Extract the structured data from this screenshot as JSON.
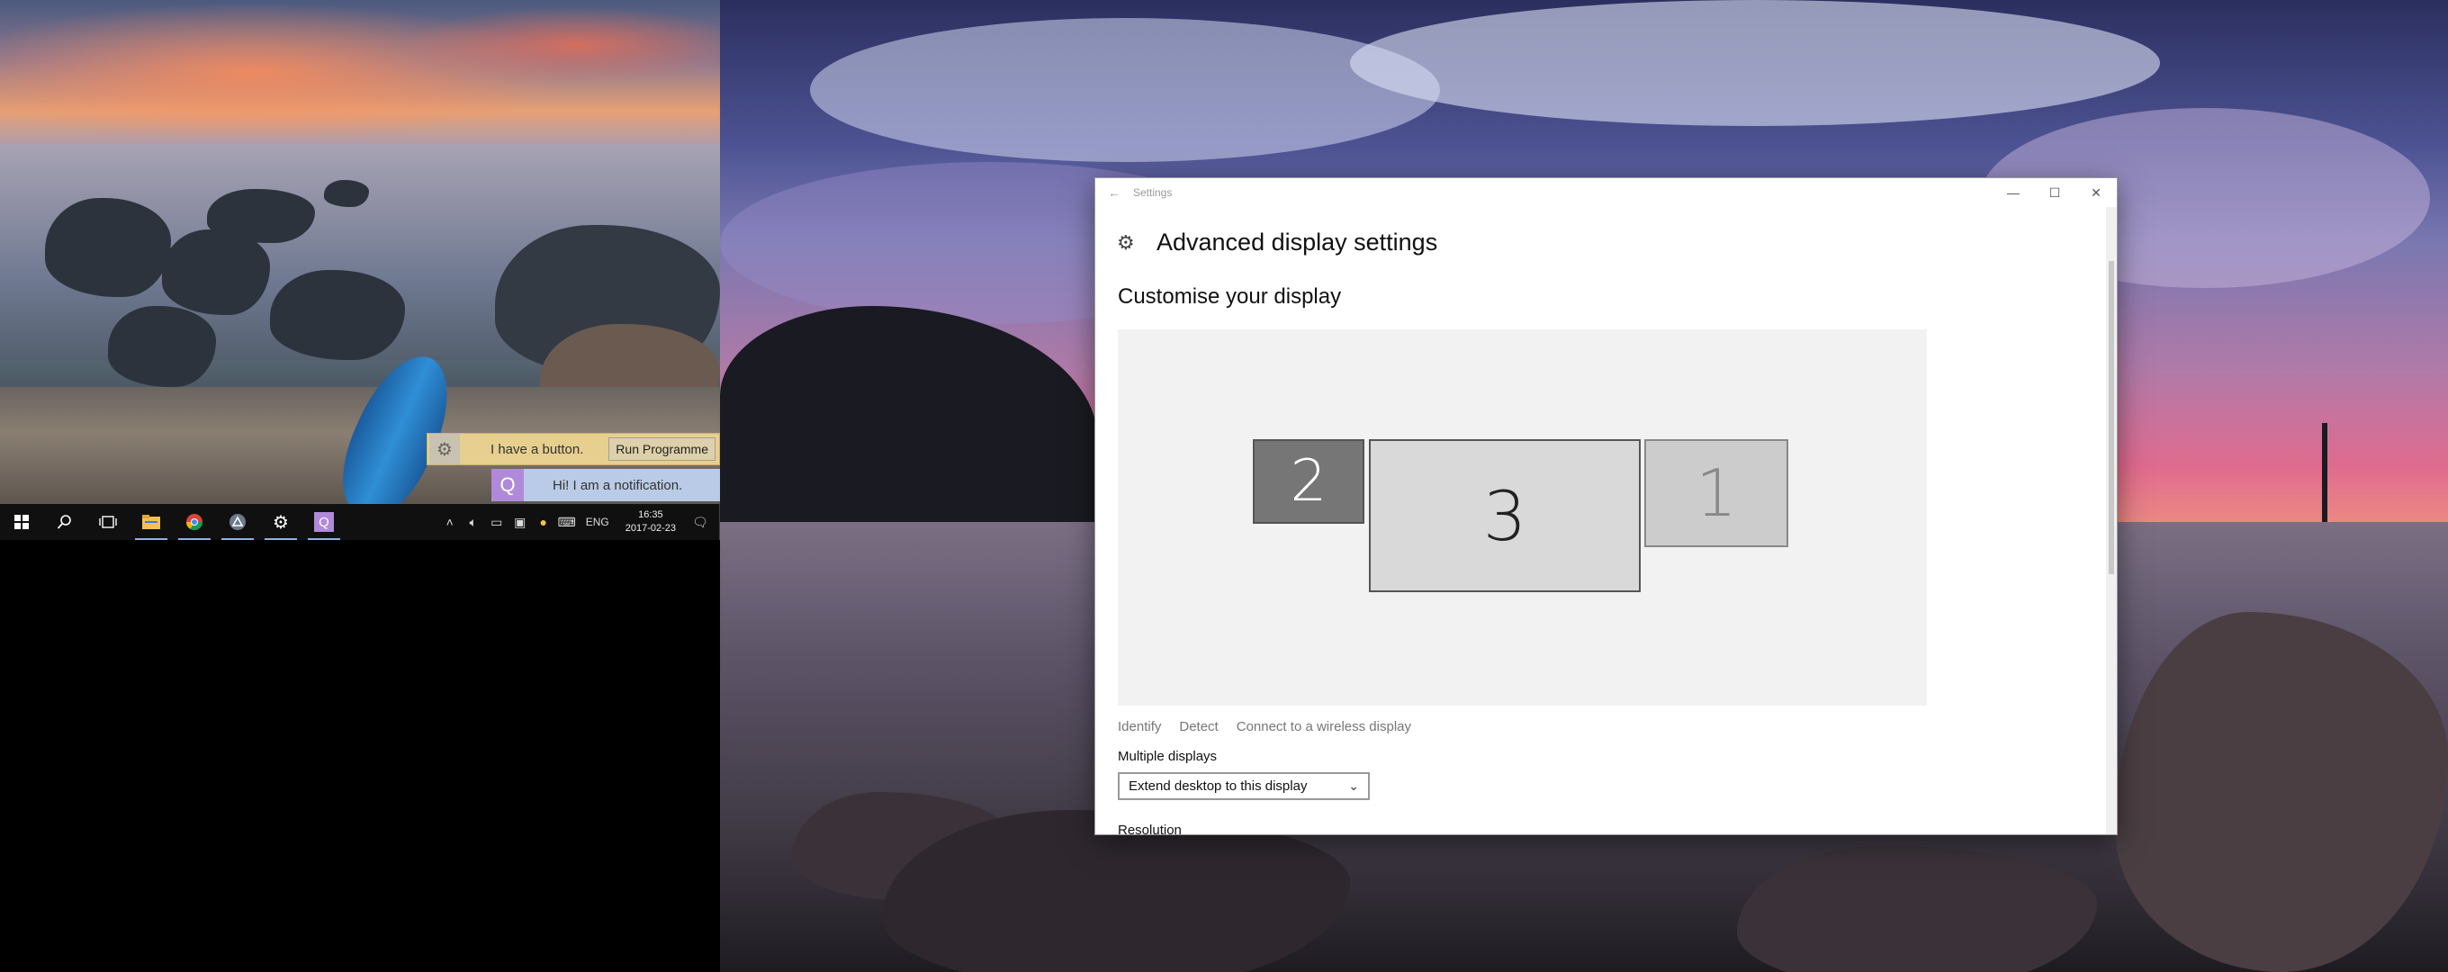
{
  "toasts": {
    "first": {
      "text": "I have a button.",
      "button": "Run Programme",
      "icon": "app-icon"
    },
    "second": {
      "text": "Hi! I am a notification.",
      "icon": "q-app-icon",
      "icon_glyph": "Q"
    }
  },
  "taskbar": {
    "items": [
      "start-icon",
      "search-icon",
      "task-view-icon",
      "file-explorer-icon",
      "chrome-icon",
      "app-icon",
      "settings-gear-icon",
      "q-app-icon"
    ],
    "tray": {
      "language": "ENG",
      "time": "16:35",
      "date": "2017-02-23"
    }
  },
  "settings_window": {
    "title": "Settings",
    "page_title": "Advanced display settings",
    "section_title": "Customise your display",
    "monitors": [
      {
        "label": "2",
        "selected": false
      },
      {
        "label": "3",
        "selected": true
      },
      {
        "label": "1",
        "selected": false
      }
    ],
    "links": {
      "identify": "Identify",
      "detect": "Detect",
      "wireless": "Connect to a wireless display"
    },
    "multiple_displays_label": "Multiple displays",
    "multiple_displays_value": "Extend desktop to this display",
    "next_section_partial": "Resolution"
  },
  "colors": {
    "taskbar": "#101010",
    "toast_yellow": "#e6cf8f",
    "toast_blue": "#b9cbe6",
    "canvas": "#f2f2f2"
  }
}
